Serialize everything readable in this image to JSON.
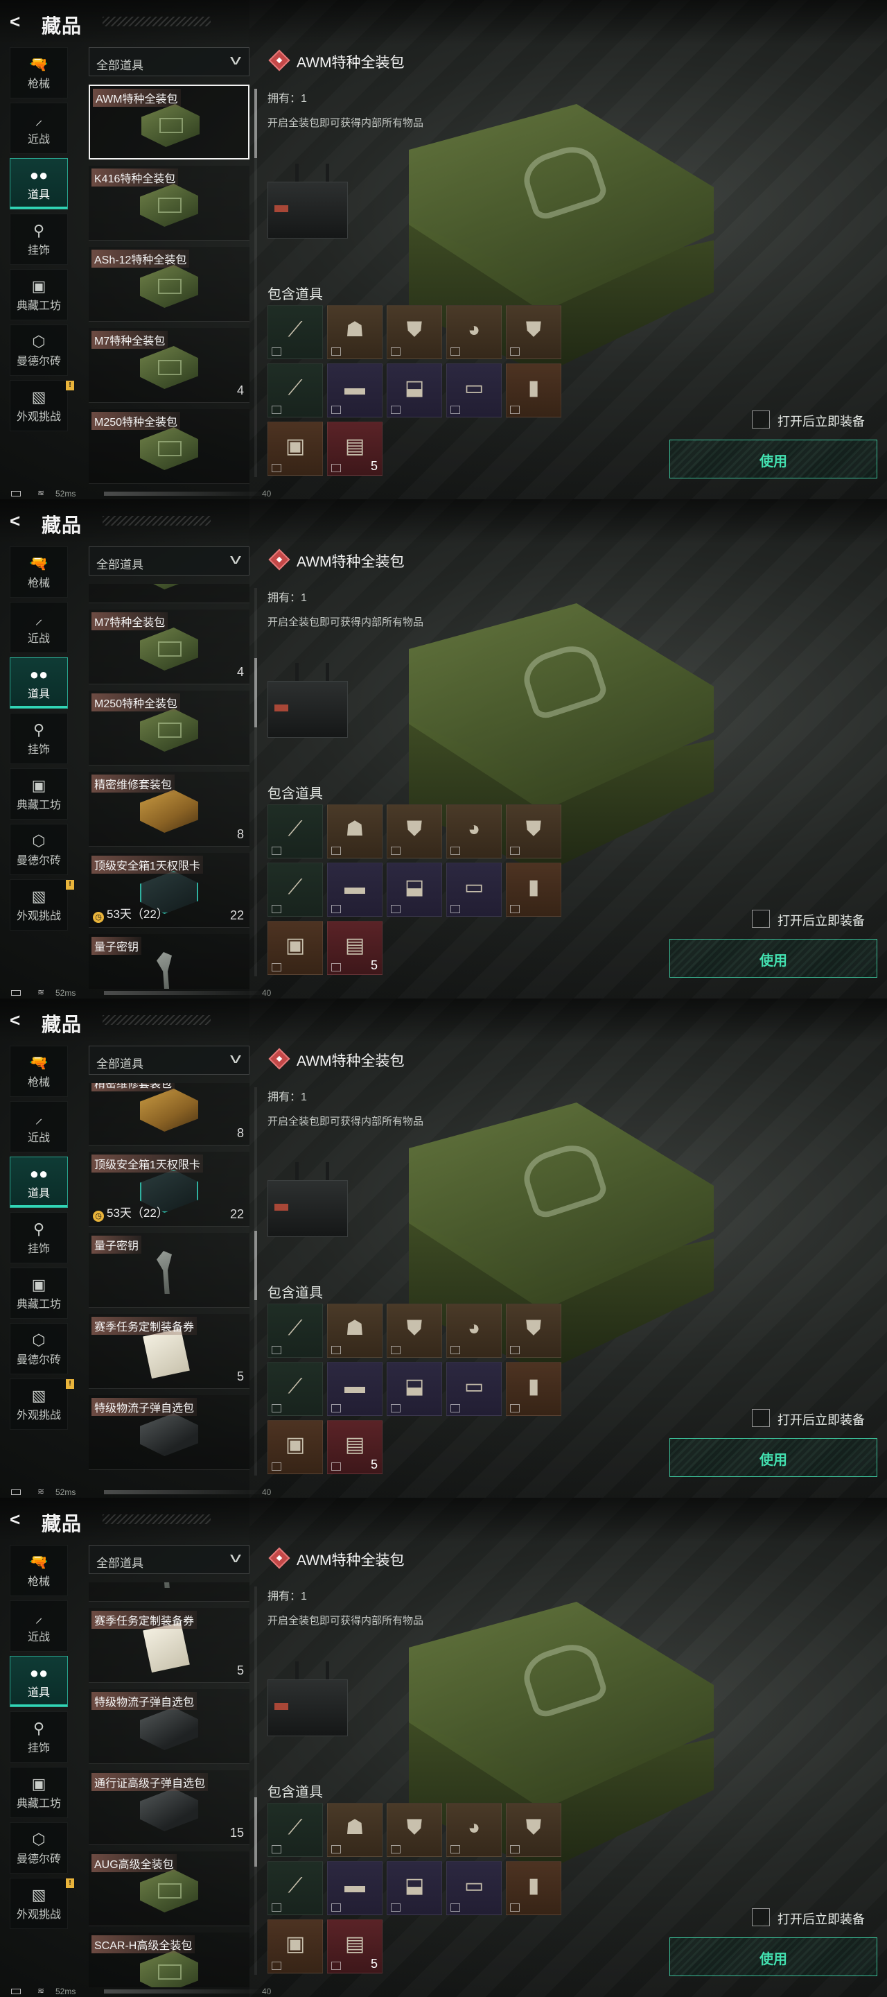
{
  "header": {
    "title": "藏品"
  },
  "sidebar": [
    {
      "label": "枪械",
      "icon": "gun-icon",
      "glyph": "🔫"
    },
    {
      "label": "近战",
      "icon": "knife-icon",
      "glyph": "⸝"
    },
    {
      "label": "道具",
      "icon": "grenade-cluster-icon",
      "glyph": "●●",
      "active": true
    },
    {
      "label": "挂饰",
      "icon": "charm-icon",
      "glyph": "⚲"
    },
    {
      "label": "典藏工坊",
      "icon": "workshop-icon",
      "glyph": "▣"
    },
    {
      "label": "曼德尔砖",
      "icon": "brick-icon",
      "glyph": "⬡"
    },
    {
      "label": "外观挑战",
      "icon": "image-challenge-icon",
      "glyph": "▧",
      "badge": "!"
    }
  ],
  "filter": {
    "label": "全部道具"
  },
  "detail": {
    "title": "AWM特种全装包",
    "owned": "拥有：1",
    "description": "开启全装包即可获得内部所有物品",
    "contains_label": "包含道具",
    "contents": [
      {
        "icon": "rifle-icon",
        "glyph": "⟋",
        "rarity": "green"
      },
      {
        "icon": "helmet-icon",
        "glyph": "☗",
        "rarity": "gold"
      },
      {
        "icon": "vest-icon",
        "glyph": "⛊",
        "rarity": "gold"
      },
      {
        "icon": "tactical-helmet-icon",
        "glyph": "◕",
        "rarity": "gold"
      },
      {
        "icon": "plate-carrier-icon",
        "glyph": "⛊",
        "rarity": "gold"
      },
      {
        "icon": "syringe-icon",
        "glyph": "⟋",
        "rarity": "green"
      },
      {
        "icon": "bandage-icon",
        "glyph": "▬",
        "rarity": "purple"
      },
      {
        "icon": "injector-icon",
        "glyph": "⬓",
        "rarity": "purple"
      },
      {
        "icon": "armor-repair-kit-icon",
        "glyph": "▭",
        "rarity": "purple"
      },
      {
        "icon": "battery-icon",
        "glyph": "▮",
        "rarity": "orange"
      },
      {
        "icon": "ammo-box-icon",
        "glyph": "▣",
        "rarity": "orange"
      },
      {
        "icon": "bullet-pack-icon",
        "glyph": "▤",
        "rarity": "red",
        "count": "5"
      }
    ],
    "equip_label": "打开后立即装备",
    "use_label": "使用"
  },
  "status": {
    "ping": "52ms",
    "right_number": "40"
  },
  "frames": [
    {
      "scroll": 0.0,
      "cards": [
        {
          "name": "AWM特种全装包",
          "thumb": "crate",
          "icon": "crate-icon",
          "selected": true
        },
        {
          "name": "K416特种全装包",
          "thumb": "crate",
          "icon": "crate-icon"
        },
        {
          "name": "ASh-12特种全装包",
          "thumb": "crate",
          "icon": "crate-icon"
        },
        {
          "name": "M7特种全装包",
          "thumb": "crate",
          "icon": "crate-icon",
          "count": "4"
        },
        {
          "name": "M250特种全装包",
          "thumb": "crate",
          "icon": "crate-icon"
        }
      ],
      "offset": 0
    },
    {
      "scroll": 0.22,
      "cards": [
        {
          "name": "",
          "thumb": "crate",
          "icon": "crate-icon"
        },
        {
          "name": "M7特种全装包",
          "thumb": "crate",
          "icon": "crate-icon",
          "count": "4"
        },
        {
          "name": "M250特种全装包",
          "thumb": "crate",
          "icon": "crate-icon"
        },
        {
          "name": "精密维修套装包",
          "thumb": "gold",
          "icon": "repair-kit-icon",
          "count": "8"
        },
        {
          "name": "顶级安全箱1天权限卡",
          "thumb": "case",
          "icon": "safe-case-icon",
          "count": "22",
          "timer": "53天（22）"
        },
        {
          "name": "量子密钥",
          "thumb": "key",
          "icon": "quantum-key-icon"
        }
      ],
      "offset": -80
    },
    {
      "scroll": 0.45,
      "cards": [
        {
          "name": "精密维修套装包",
          "thumb": "gold",
          "icon": "repair-kit-icon",
          "count": "8"
        },
        {
          "name": "顶级安全箱1天权限卡",
          "thumb": "case",
          "icon": "safe-case-icon",
          "count": "22",
          "timer": "53天（22）"
        },
        {
          "name": "量子密钥",
          "thumb": "key",
          "icon": "quantum-key-icon"
        },
        {
          "name": "赛季任务定制装备券",
          "thumb": "paper",
          "icon": "voucher-icon",
          "count": "5"
        },
        {
          "name": "特级物流子弹自选包",
          "thumb": "box",
          "icon": "ammo-crate-icon"
        }
      ],
      "offset": -18
    },
    {
      "scroll": 0.66,
      "cards": [
        {
          "name": "",
          "thumb": "key",
          "icon": "quantum-key-icon"
        },
        {
          "name": "赛季任务定制装备券",
          "thumb": "paper",
          "icon": "voucher-icon",
          "count": "5"
        },
        {
          "name": "特级物流子弹自选包",
          "thumb": "box",
          "icon": "ammo-crate-icon"
        },
        {
          "name": "通行证高级子弹自选包",
          "thumb": "box",
          "icon": "ammo-crate-icon",
          "count": "15"
        },
        {
          "name": "AUG高级全装包",
          "thumb": "crate",
          "icon": "crate-icon"
        },
        {
          "name": "SCAR-H高级全装包",
          "thumb": "crate",
          "icon": "crate-icon"
        }
      ],
      "offset": -80
    }
  ]
}
